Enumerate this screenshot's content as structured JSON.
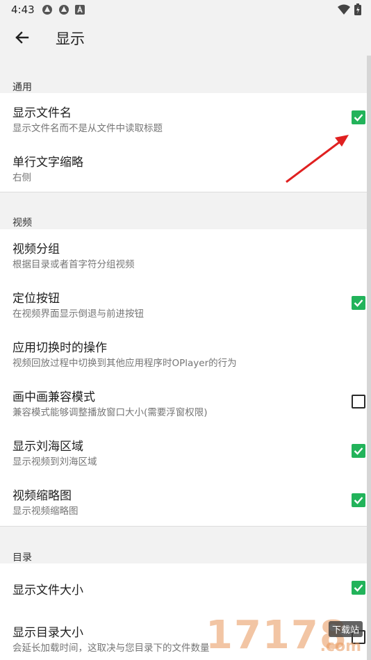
{
  "status": {
    "time": "4:43"
  },
  "appbar": {
    "title": "显示"
  },
  "sections": {
    "general": {
      "header": "通用",
      "items": [
        {
          "title": "显示文件名",
          "subtitle": "显示文件名而不是从文件中读取标题",
          "checked": true
        },
        {
          "title": "单行文字缩略",
          "subtitle": "右侧"
        }
      ]
    },
    "video": {
      "header": "视频",
      "items": [
        {
          "title": "视频分组",
          "subtitle": "根据目录或者首字符分组视频"
        },
        {
          "title": "定位按钮",
          "subtitle": "在视频界面显示倒退与前进按钮",
          "checked": true
        },
        {
          "title": "应用切换时的操作",
          "subtitle": "视频回放过程中切换到其他应用程序时OPlayer的行为"
        },
        {
          "title": "画中画兼容模式",
          "subtitle": "兼容模式能够调整播放窗口大小(需要浮窗权限)",
          "checked": false
        },
        {
          "title": "显示刘海区域",
          "subtitle": "显示视频到刘海区域",
          "checked": true
        },
        {
          "title": "视频缩略图",
          "subtitle": "显示视频缩略图",
          "checked": true
        }
      ]
    },
    "directory": {
      "header": "目录",
      "items": [
        {
          "title": "显示文件大小",
          "checked": true
        },
        {
          "title": "显示目录大小",
          "subtitle": "会延长加载时间，这取决与您目录下的文件数量",
          "checked": false
        }
      ]
    }
  },
  "watermark": {
    "text": "17178",
    "tag": "下载站",
    "domain": ".com"
  },
  "colors": {
    "checkbox_on": "#22b35a",
    "arrow": "#e02020",
    "background": "#f2f2f2"
  }
}
